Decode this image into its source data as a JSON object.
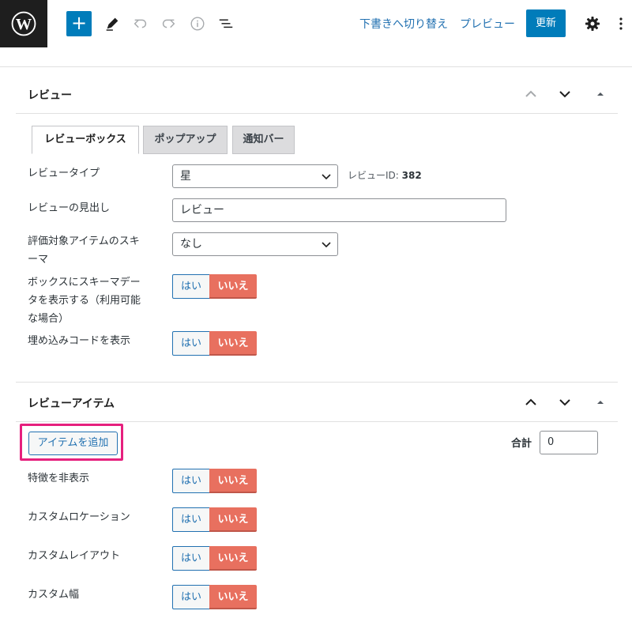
{
  "toolbar": {
    "add_symbol": "+",
    "switch_to_draft": "下書きへ切り替え",
    "preview": "プレビュー",
    "update": "更新"
  },
  "review_panel": {
    "title": "レビュー",
    "tabs": [
      {
        "label": "レビューボックス",
        "active": true
      },
      {
        "label": "ポップアップ",
        "active": false
      },
      {
        "label": "通知バー",
        "active": false
      }
    ],
    "review_type": {
      "label": "レビュータイプ",
      "value": "星"
    },
    "review_id": {
      "label": "レビューID:",
      "value": "382"
    },
    "heading": {
      "label": "レビューの見出し",
      "value": "レビュー"
    },
    "schema": {
      "label_line1": "評価対象アイテムのスキ",
      "label_line2": "ーマ",
      "value": "なし"
    },
    "show_schema": {
      "label_line1": "ボックスにスキーマデー",
      "label_line2": "タを表示する（利用可能",
      "label_line3": "な場合）",
      "yes": "はい",
      "no": "いいえ"
    },
    "show_embed": {
      "label": "埋め込みコードを表示",
      "yes": "はい",
      "no": "いいえ"
    }
  },
  "items_panel": {
    "title": "レビューアイテム",
    "add_item": "アイテムを追加",
    "total_label": "合計",
    "total_value": "0",
    "rows": [
      {
        "label": "特徴を非表示",
        "yes": "はい",
        "no": "いいえ"
      },
      {
        "label": "カスタムロケーション",
        "yes": "はい",
        "no": "いいえ"
      },
      {
        "label": "カスタムレイアウト",
        "yes": "はい",
        "no": "いいえ"
      },
      {
        "label": "カスタム幅",
        "yes": "はい",
        "no": "いいえ"
      }
    ]
  },
  "colors": {
    "accent": "#007cba",
    "link": "#2271b1",
    "no_button": "#e8705f",
    "highlight": "#e6207e"
  }
}
